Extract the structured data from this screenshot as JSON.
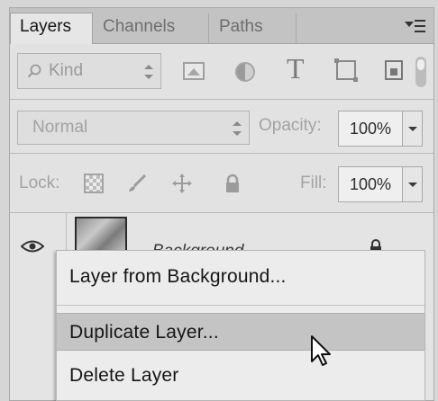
{
  "tabs": [
    {
      "label": "Layers",
      "active": true
    },
    {
      "label": "Channels",
      "active": false
    },
    {
      "label": "Paths",
      "active": false
    }
  ],
  "panel_menu_icon": "panel-menu-icon",
  "filter": {
    "kind_label": "Kind",
    "icons": [
      "image-filter-icon",
      "adjustment-filter-icon",
      "type-filter-icon",
      "shape-filter-icon",
      "smart-object-filter-icon"
    ]
  },
  "blend": {
    "mode": "Normal",
    "opacity_label": "Opacity:",
    "opacity_value": "100%"
  },
  "lock": {
    "label": "Lock:",
    "fill_label": "Fill:",
    "fill_value": "100%"
  },
  "layer": {
    "name": "Background",
    "visible": true,
    "locked": true
  },
  "context_menu": {
    "items": [
      {
        "label": "Layer from Background...",
        "state": "normal"
      },
      {
        "label": "Duplicate Layer...",
        "state": "hover"
      },
      {
        "label": "Delete Layer",
        "state": "normal"
      }
    ]
  },
  "colors": {
    "panel_bg": "#dcdcdc",
    "menu_bg": "#ececec",
    "menu_hover": "#c4c4c4"
  }
}
